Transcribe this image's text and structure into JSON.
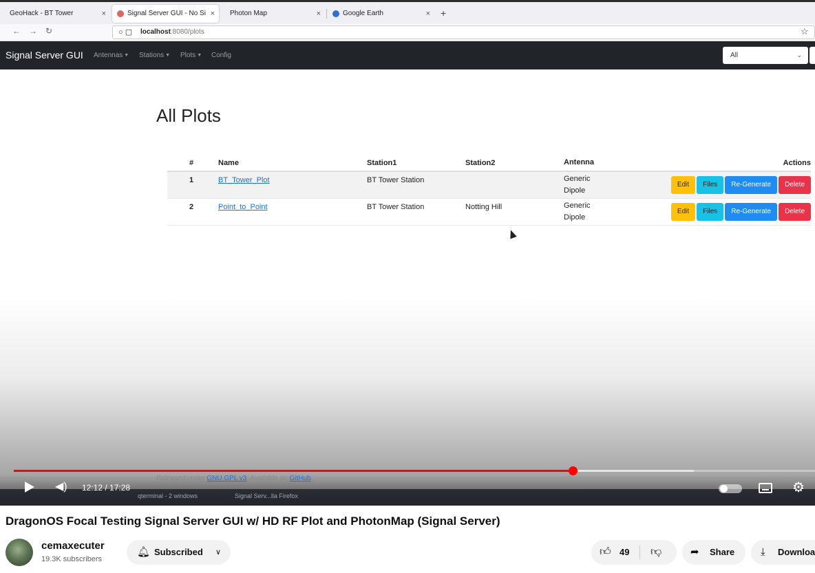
{
  "browser": {
    "tabs": [
      {
        "label": "GeoHack - BT Tower",
        "active": false
      },
      {
        "label": "Signal Server GUI - No Si",
        "active": true
      },
      {
        "label": "Photon Map",
        "active": false
      },
      {
        "label": "Google Earth",
        "active": false
      }
    ],
    "url_host": "localhost",
    "url_path": ":8080/plots"
  },
  "app": {
    "brand": "Signal Server GUI",
    "nav": [
      "Antennas",
      "Stations",
      "Plots",
      "Config"
    ],
    "select_value": "All"
  },
  "page": {
    "title": "All Plots",
    "columns": [
      "#",
      "Name",
      "Station1",
      "Station2",
      "Antenna",
      "Actions"
    ],
    "rows": [
      {
        "num": "1",
        "name": "BT_Tower_Plot",
        "station1": "BT Tower Station",
        "station2": "",
        "antenna_line1": "Generic",
        "antenna_line2": "Dipole"
      },
      {
        "num": "2",
        "name": "Point_to_Point",
        "station1": "BT Tower Station",
        "station2": "Notting Hill",
        "antenna_line1": "Generic",
        "antenna_line2": "Dipole"
      }
    ],
    "actions": {
      "edit": "Edit",
      "files": "Files",
      "regenerate": "Re-Generate",
      "delete": "Delete"
    },
    "footer": {
      "prefix": "Released under ",
      "license_link": "GNU GPL v3",
      "middle": ". Available on ",
      "github_link": "GitHub",
      "suffix": "."
    }
  },
  "taskbar": {
    "item1": "qterminal - 2 windows",
    "item2": "Signal Serv...lla Firefox"
  },
  "player": {
    "current_time": "12:12",
    "duration": "17:28",
    "time_display": "12:12 / 17:28",
    "progress_fraction": 0.698,
    "buffer_fraction": 0.849,
    "accent_color": "#ff0000"
  },
  "video": {
    "title": "DragonOS Focal Testing Signal Server GUI w/ HD RF Plot and PhotonMap (Signal Server)",
    "channel": "cemaxecuter",
    "subscribers": "19.3K subscribers",
    "subscribe_label": "Subscribed",
    "likes": "49",
    "share_label": "Share",
    "download_label": "Download"
  },
  "icons": {
    "back": "arrow-left-icon",
    "forward": "arrow-right-icon",
    "reload": "reload-icon",
    "bookmark": "star-icon",
    "play": "play-icon",
    "volume": "volume-icon",
    "settings": "gear-icon",
    "bell": "bell-icon",
    "like": "thumbs-up-icon",
    "dislike": "thumbs-down-icon",
    "share": "share-icon",
    "download": "download-icon"
  }
}
